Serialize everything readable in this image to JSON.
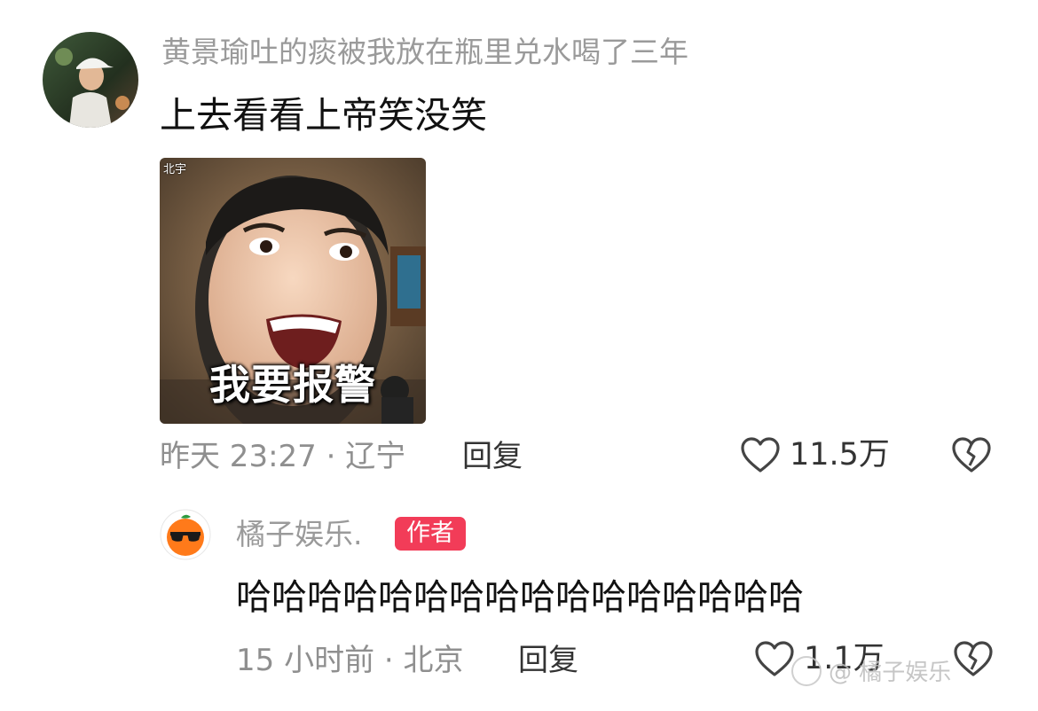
{
  "comment": {
    "username": "黄景瑜吐的痰被我放在瓶里兑水喝了三年",
    "text": "上去看看上帝笑没笑",
    "image_caption": "我要报警",
    "image_corner_text": "北宇",
    "meta": "昨天 23:27 · 辽宁",
    "reply_label": "回复",
    "like_count": "11.5万",
    "icons": {
      "like": "heart-outline-icon",
      "dislike": "broken-heart-icon"
    }
  },
  "reply": {
    "username": "橘子娱乐.",
    "badge": "作者",
    "text": "哈哈哈哈哈哈哈哈哈哈哈哈哈哈哈哈",
    "meta": "15 小时前 · 北京",
    "reply_label": "回复",
    "like_count": "1.1万",
    "badge_color": "#f23c58"
  },
  "watermark": {
    "text": "@ 橘子娱乐"
  }
}
